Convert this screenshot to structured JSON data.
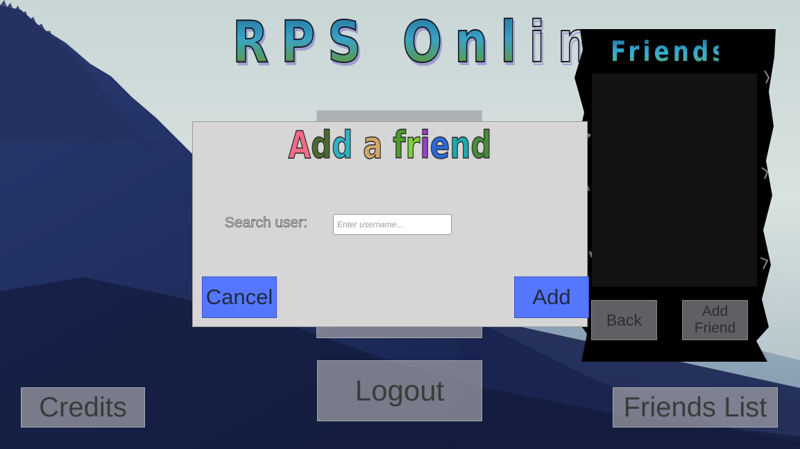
{
  "game": {
    "title": "RPS Online"
  },
  "main_menu": {
    "logout_label": "Logout",
    "credits_label": "Credits",
    "friends_list_label": "Friends List"
  },
  "friends_panel": {
    "title": "Friends",
    "back_label": "Back",
    "add_friend_label": "Add\nFriend"
  },
  "dialog": {
    "title_letters": [
      {
        "ch": "A",
        "color": "#f06b8a"
      },
      {
        "ch": "d",
        "color": "#4a6a30"
      },
      {
        "ch": "d",
        "color": "#2fb3c4"
      },
      {
        "ch": " ",
        "color": "#000000"
      },
      {
        "ch": "a",
        "color": "#d2a86a"
      },
      {
        "ch": " ",
        "color": "#000000"
      },
      {
        "ch": "f",
        "color": "#4f9b2d"
      },
      {
        "ch": "r",
        "color": "#7ed23a"
      },
      {
        "ch": "i",
        "color": "#9a3fd0"
      },
      {
        "ch": "e",
        "color": "#2a6ae0"
      },
      {
        "ch": "n",
        "color": "#1fa8b0"
      },
      {
        "ch": "d",
        "color": "#4a8a3a"
      }
    ],
    "search_label": "Search user:",
    "search_placeholder": "Enter username...",
    "search_value": "",
    "cancel_label": "Cancel",
    "add_label": "Add"
  },
  "colors": {
    "dialog_button": "#5577ff",
    "dialog_background": "#d6d6d6",
    "panel_background": "#000000"
  }
}
